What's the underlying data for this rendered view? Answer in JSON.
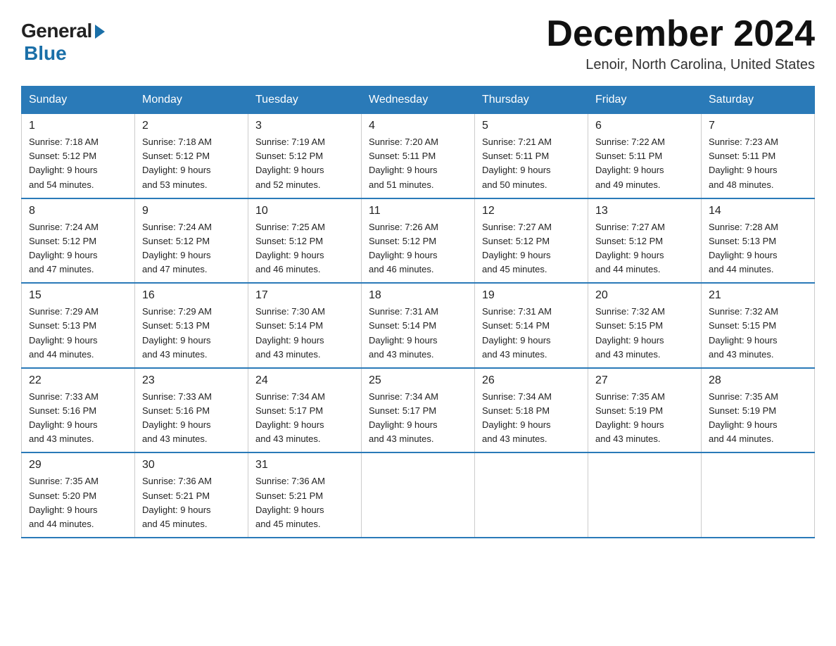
{
  "logo": {
    "general": "General",
    "blue": "Blue"
  },
  "title": "December 2024",
  "location": "Lenoir, North Carolina, United States",
  "weekdays": [
    "Sunday",
    "Monday",
    "Tuesday",
    "Wednesday",
    "Thursday",
    "Friday",
    "Saturday"
  ],
  "weeks": [
    [
      {
        "day": "1",
        "sunrise": "7:18 AM",
        "sunset": "5:12 PM",
        "daylight": "9 hours and 54 minutes."
      },
      {
        "day": "2",
        "sunrise": "7:18 AM",
        "sunset": "5:12 PM",
        "daylight": "9 hours and 53 minutes."
      },
      {
        "day": "3",
        "sunrise": "7:19 AM",
        "sunset": "5:12 PM",
        "daylight": "9 hours and 52 minutes."
      },
      {
        "day": "4",
        "sunrise": "7:20 AM",
        "sunset": "5:11 PM",
        "daylight": "9 hours and 51 minutes."
      },
      {
        "day": "5",
        "sunrise": "7:21 AM",
        "sunset": "5:11 PM",
        "daylight": "9 hours and 50 minutes."
      },
      {
        "day": "6",
        "sunrise": "7:22 AM",
        "sunset": "5:11 PM",
        "daylight": "9 hours and 49 minutes."
      },
      {
        "day": "7",
        "sunrise": "7:23 AM",
        "sunset": "5:11 PM",
        "daylight": "9 hours and 48 minutes."
      }
    ],
    [
      {
        "day": "8",
        "sunrise": "7:24 AM",
        "sunset": "5:12 PM",
        "daylight": "9 hours and 47 minutes."
      },
      {
        "day": "9",
        "sunrise": "7:24 AM",
        "sunset": "5:12 PM",
        "daylight": "9 hours and 47 minutes."
      },
      {
        "day": "10",
        "sunrise": "7:25 AM",
        "sunset": "5:12 PM",
        "daylight": "9 hours and 46 minutes."
      },
      {
        "day": "11",
        "sunrise": "7:26 AM",
        "sunset": "5:12 PM",
        "daylight": "9 hours and 46 minutes."
      },
      {
        "day": "12",
        "sunrise": "7:27 AM",
        "sunset": "5:12 PM",
        "daylight": "9 hours and 45 minutes."
      },
      {
        "day": "13",
        "sunrise": "7:27 AM",
        "sunset": "5:12 PM",
        "daylight": "9 hours and 44 minutes."
      },
      {
        "day": "14",
        "sunrise": "7:28 AM",
        "sunset": "5:13 PM",
        "daylight": "9 hours and 44 minutes."
      }
    ],
    [
      {
        "day": "15",
        "sunrise": "7:29 AM",
        "sunset": "5:13 PM",
        "daylight": "9 hours and 44 minutes."
      },
      {
        "day": "16",
        "sunrise": "7:29 AM",
        "sunset": "5:13 PM",
        "daylight": "9 hours and 43 minutes."
      },
      {
        "day": "17",
        "sunrise": "7:30 AM",
        "sunset": "5:14 PM",
        "daylight": "9 hours and 43 minutes."
      },
      {
        "day": "18",
        "sunrise": "7:31 AM",
        "sunset": "5:14 PM",
        "daylight": "9 hours and 43 minutes."
      },
      {
        "day": "19",
        "sunrise": "7:31 AM",
        "sunset": "5:14 PM",
        "daylight": "9 hours and 43 minutes."
      },
      {
        "day": "20",
        "sunrise": "7:32 AM",
        "sunset": "5:15 PM",
        "daylight": "9 hours and 43 minutes."
      },
      {
        "day": "21",
        "sunrise": "7:32 AM",
        "sunset": "5:15 PM",
        "daylight": "9 hours and 43 minutes."
      }
    ],
    [
      {
        "day": "22",
        "sunrise": "7:33 AM",
        "sunset": "5:16 PM",
        "daylight": "9 hours and 43 minutes."
      },
      {
        "day": "23",
        "sunrise": "7:33 AM",
        "sunset": "5:16 PM",
        "daylight": "9 hours and 43 minutes."
      },
      {
        "day": "24",
        "sunrise": "7:34 AM",
        "sunset": "5:17 PM",
        "daylight": "9 hours and 43 minutes."
      },
      {
        "day": "25",
        "sunrise": "7:34 AM",
        "sunset": "5:17 PM",
        "daylight": "9 hours and 43 minutes."
      },
      {
        "day": "26",
        "sunrise": "7:34 AM",
        "sunset": "5:18 PM",
        "daylight": "9 hours and 43 minutes."
      },
      {
        "day": "27",
        "sunrise": "7:35 AM",
        "sunset": "5:19 PM",
        "daylight": "9 hours and 43 minutes."
      },
      {
        "day": "28",
        "sunrise": "7:35 AM",
        "sunset": "5:19 PM",
        "daylight": "9 hours and 44 minutes."
      }
    ],
    [
      {
        "day": "29",
        "sunrise": "7:35 AM",
        "sunset": "5:20 PM",
        "daylight": "9 hours and 44 minutes."
      },
      {
        "day": "30",
        "sunrise": "7:36 AM",
        "sunset": "5:21 PM",
        "daylight": "9 hours and 45 minutes."
      },
      {
        "day": "31",
        "sunrise": "7:36 AM",
        "sunset": "5:21 PM",
        "daylight": "9 hours and 45 minutes."
      },
      null,
      null,
      null,
      null
    ]
  ],
  "labels": {
    "sunrise": "Sunrise:",
    "sunset": "Sunset:",
    "daylight": "Daylight:"
  }
}
